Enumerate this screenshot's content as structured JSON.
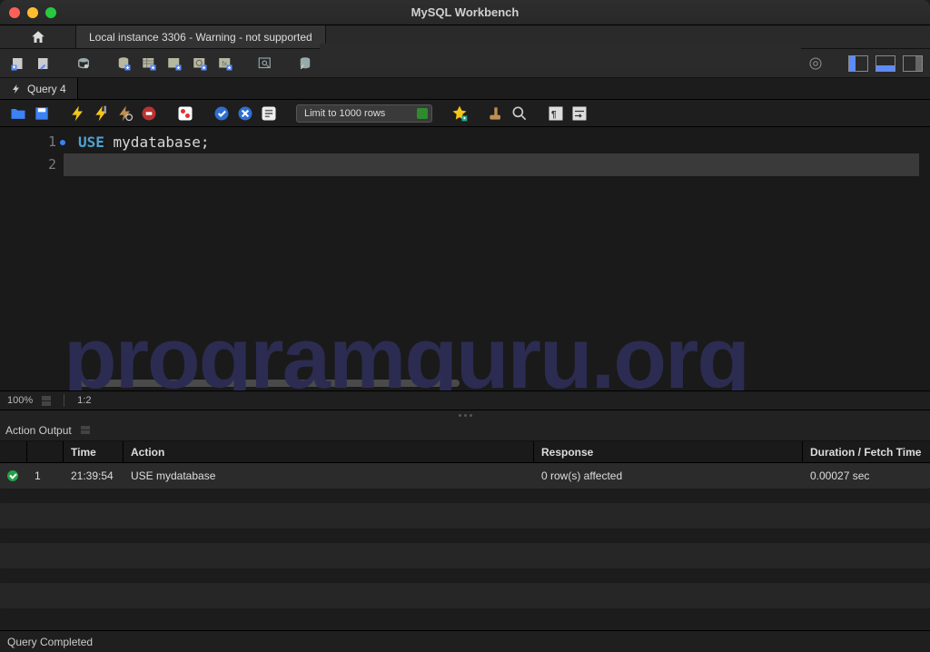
{
  "window": {
    "title": "MySQL Workbench"
  },
  "connection_tab": {
    "label": "Local instance 3306 - Warning - not supported"
  },
  "query_tab": {
    "label": "Query 4"
  },
  "editor_toolbar": {
    "limit_label": "Limit to 1000 rows"
  },
  "editor": {
    "lines": [
      {
        "n": "1",
        "kw": "USE",
        "ident": " mydatabase",
        "punct": ";"
      },
      {
        "n": "2",
        "kw": "",
        "ident": "",
        "punct": ""
      }
    ],
    "watermark": "programguru.org"
  },
  "editor_status": {
    "zoom": "100%",
    "cursor": "1:2"
  },
  "output": {
    "selector": "Action Output",
    "columns": {
      "idx": "",
      "num": "",
      "time": "Time",
      "action": "Action",
      "response": "Response",
      "duration": "Duration / Fetch Time"
    },
    "rows": [
      {
        "num": "1",
        "time": "21:39:54",
        "action": "USE mydatabase",
        "response": "0 row(s) affected",
        "duration": "0.00027 sec"
      }
    ]
  },
  "footer": {
    "status": "Query Completed"
  }
}
